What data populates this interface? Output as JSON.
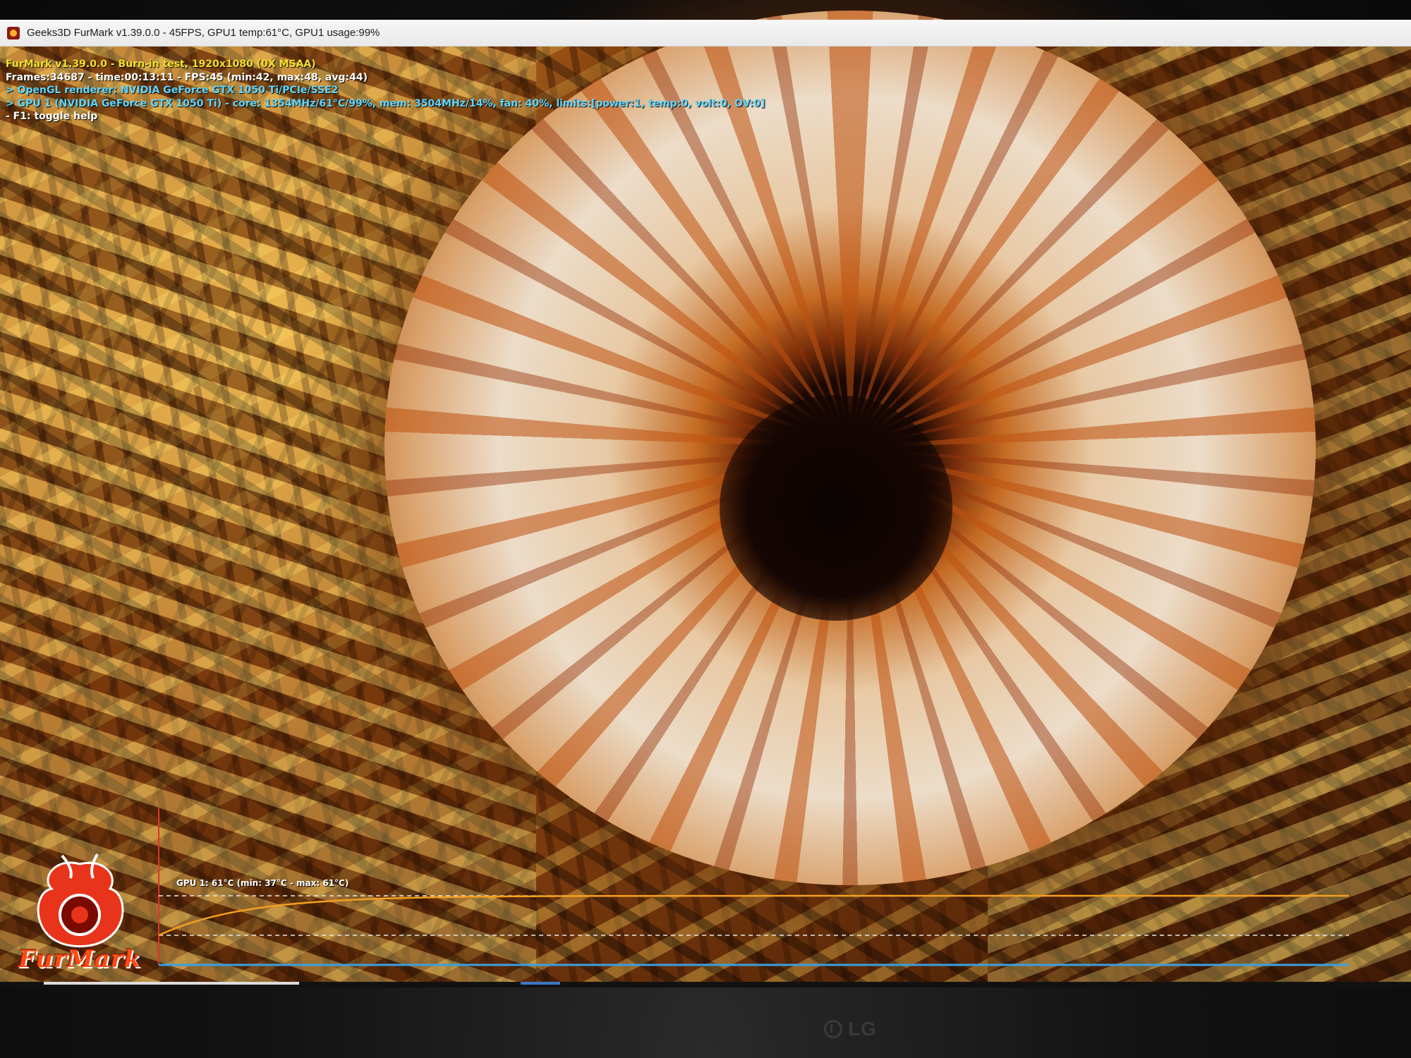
{
  "window": {
    "title": "Geeks3D FurMark v1.39.0.0 - 45FPS, GPU1 temp:61°C, GPU1 usage:99%",
    "icon": "furmark-app-icon"
  },
  "hud": {
    "line1": "FurMark v1.39.0.0 - Burn-in test, 1920x1080 (0X MSAA)",
    "line2": "Frames:34687 - time:00:13:11 - FPS:45 (min:42, max:48, avg:44)",
    "line3": "> OpenGL renderer: NVIDIA GeForce GTX 1050 Ti/PCIe/SSE2",
    "line4": "> GPU 1 (NVIDIA GeForce GTX 1050 Ti) - core: 1354MHz/61°C/99%, mem: 3504MHz/14%, fan: 40%, limits:[power:1, temp:0, volt:0, OV:0]",
    "line5": "- F1: toggle help"
  },
  "temp_graph": {
    "label": "GPU 1: 61°C (min: 37°C - max: 61°C)",
    "min_temp": 37,
    "max_temp": 61,
    "current_temp": 61,
    "line_color": "#f4a020",
    "axis_color": "#3aa0e0"
  },
  "logo": {
    "text": "FurMark"
  },
  "monitor": {
    "brand": "LG"
  }
}
